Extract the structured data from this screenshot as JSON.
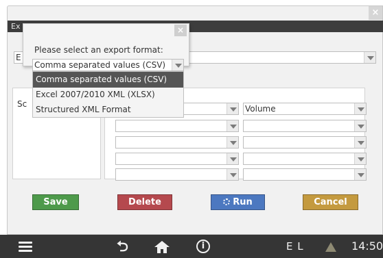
{
  "window": {
    "close_glyph": "×",
    "title": "Ex"
  },
  "export_combo": {
    "value": "E"
  },
  "left_panel": {
    "label": "Sc"
  },
  "column_rows": [
    {
      "left": "",
      "right": "Volume"
    },
    {
      "left": "",
      "right": ""
    },
    {
      "left": "",
      "right": ""
    },
    {
      "left": "",
      "right": ""
    },
    {
      "left": "",
      "right": ""
    }
  ],
  "buttons": {
    "save": "Save",
    "delete": "Delete",
    "run": "Run",
    "cancel": "Cancel"
  },
  "colors": {
    "save": "#4e9a4b",
    "delete": "#b5494e",
    "run": "#4c78c0",
    "cancel": "#c49a3f"
  },
  "taskbar": {
    "back_glyph": "⮌",
    "info_glyph": "i",
    "language": "E L",
    "clock": "14:50"
  },
  "dialog": {
    "close_glyph": "×",
    "label": "Please select an export format:",
    "selected": "Comma separated values (CSV)",
    "options": [
      "Comma separated values (CSV)",
      "Excel 2007/2010 XML (XLSX)",
      "Structured XML Format"
    ]
  }
}
